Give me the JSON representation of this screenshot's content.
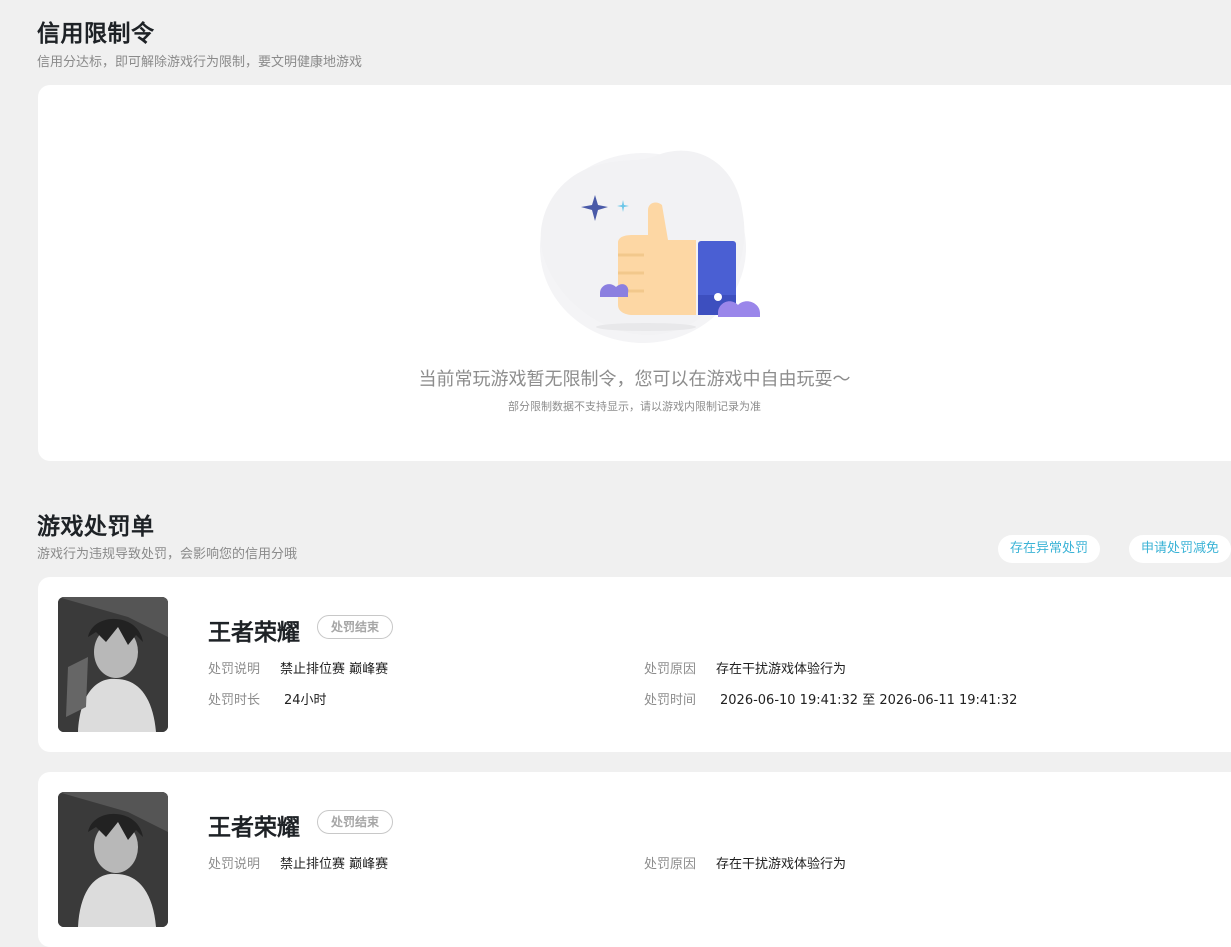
{
  "credit": {
    "title": "信用限制令",
    "subtitle": "信用分达标，即可解除游戏行为限制，要文明健康地游戏",
    "empty_message": "当前常玩游戏暂无限制令，您可以在游戏中自由玩耍～",
    "empty_note": "部分限制数据不支持显示，请以游戏内限制记录为准",
    "illustration": "thumbs-up-illustration"
  },
  "penalty": {
    "title": "游戏处罚单",
    "subtitle": "游戏行为违规导致处罚，会影响您的信用分哦",
    "actions": {
      "abnormal_label": "存在异常处罚",
      "appeal_label": "申请处罚减免"
    },
    "labels": {
      "desc": "处罚说明",
      "reason": "处罚原因",
      "duration": "处罚时长",
      "time": "处罚时间"
    },
    "items": [
      {
        "game": "王者荣耀",
        "status": "处罚结束",
        "desc": "禁止排位赛 巅峰赛",
        "reason": "存在干扰游戏体验行为",
        "duration": "24小时",
        "time": "2026-06-10 19:41:32 至 2026-06-11 19:41:32"
      },
      {
        "game": "王者荣耀",
        "status": "处罚结束",
        "desc": "禁止排位赛 巅峰赛",
        "reason": "存在干扰游戏体验行为",
        "duration": "",
        "time": ""
      }
    ]
  },
  "colors": {
    "accent": "#3bb3d6",
    "background": "#f0f0f0",
    "card": "#ffffff"
  }
}
